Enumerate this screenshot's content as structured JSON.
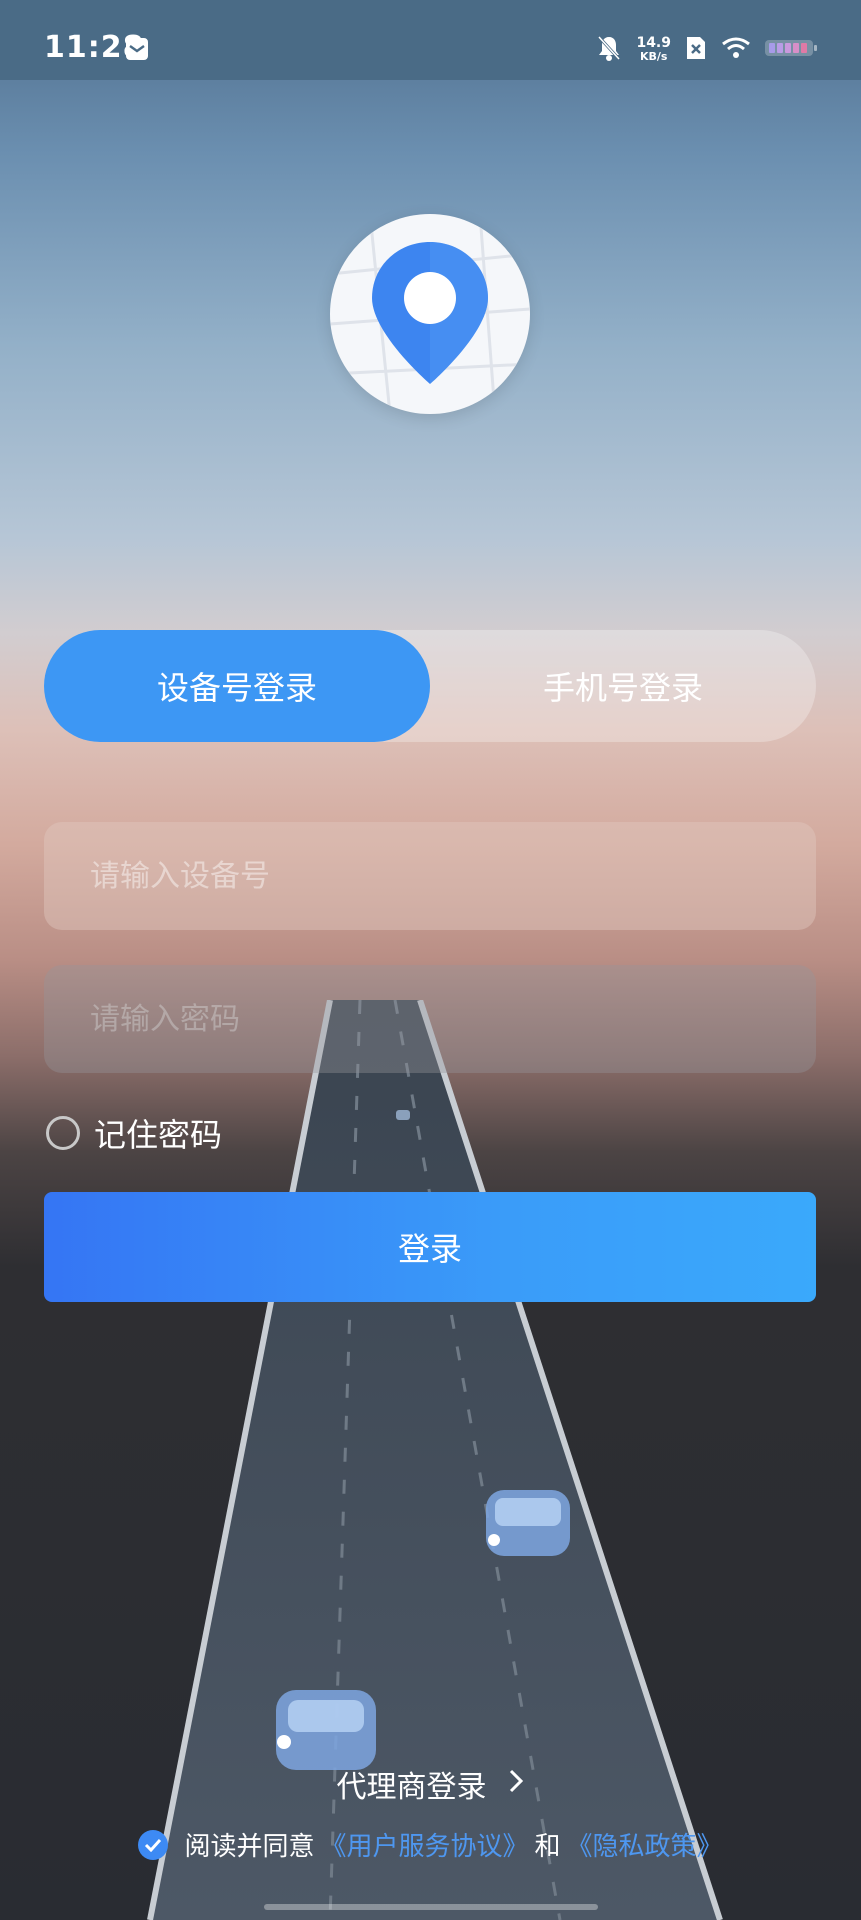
{
  "status_bar": {
    "time": "11:28",
    "net_speed_value": "14.9",
    "net_speed_unit": "KB/s"
  },
  "tabs": {
    "device": "设备号登录",
    "phone": "手机号登录",
    "active": "device"
  },
  "form": {
    "device_placeholder": "请输入设备号",
    "password_placeholder": "请输入密码",
    "remember_label": "记住密码",
    "login_label": "登录"
  },
  "footer": {
    "agent_login": "代理商登录",
    "agree_prefix": "阅读并同意",
    "user_agreement": "《用户服务协议》",
    "and": "和",
    "privacy_policy": "《隐私政策》"
  },
  "colors": {
    "accent": "#3d97f4",
    "link": "#4e97f0"
  }
}
